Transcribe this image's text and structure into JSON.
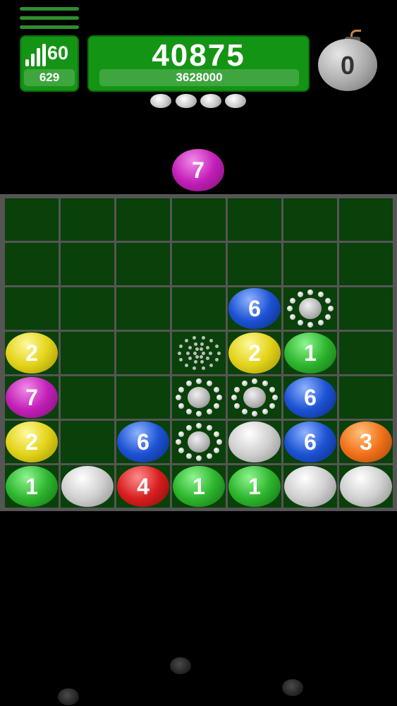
{
  "hud": {
    "menu_icon": "hamburger-menu-icon",
    "level": {
      "icon": "signal-bars-icon",
      "value": "60",
      "sub_value": "629"
    },
    "score": {
      "value": "40875",
      "target": "3628000"
    },
    "bomb": {
      "icon": "bomb-icon",
      "count": "0"
    },
    "pellets_remaining": 4
  },
  "next_ball": {
    "value": "7",
    "color": "#c31fb8"
  },
  "board": {
    "columns": 7,
    "rows": 7,
    "cells": [
      [
        "",
        "",
        "",
        "",
        "",
        "",
        ""
      ],
      [
        "",
        "",
        "",
        "",
        "",
        "",
        ""
      ],
      [
        "",
        "",
        "",
        "",
        "6",
        "ring",
        ""
      ],
      [
        "2",
        "",
        "",
        "ring-small",
        "2",
        "1",
        ""
      ],
      [
        "7",
        "",
        "",
        "ring",
        "ring",
        "6",
        ""
      ],
      [
        "2",
        "",
        "6",
        "ring",
        "grey",
        "6",
        "3"
      ],
      [
        "1",
        "grey",
        "4",
        "1",
        "1",
        "grey",
        "grey"
      ]
    ],
    "colors": {
      "1": "#2eb52e",
      "2": "#e3d31a",
      "3": "#f2711a",
      "4": "#d81e1e",
      "6": "#1c52d4",
      "7": "#c31fb8",
      "grey": "#cfcfcf",
      "cell": "#0a400a",
      "grid": "#555555"
    }
  }
}
